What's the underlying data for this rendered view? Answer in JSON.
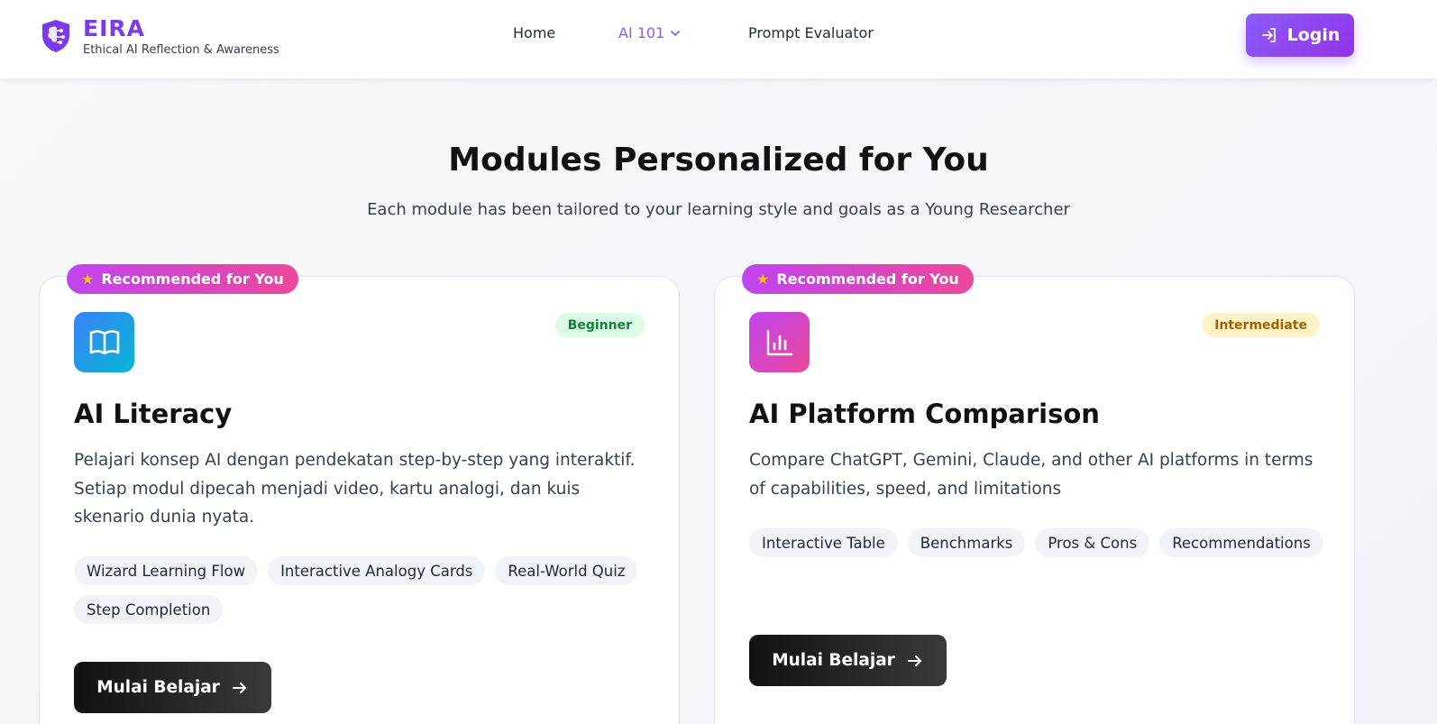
{
  "brand": {
    "name": "EIRA",
    "tagline": "Ethical AI Reflection & Awareness",
    "icon": "shield-brain-icon",
    "accent_color": "#7c3aed"
  },
  "nav": {
    "home": "Home",
    "ai101": "AI 101",
    "prompt_evaluator": "Prompt Evaluator",
    "login": "Login"
  },
  "hero": {
    "title": "Modules Personalized for You",
    "subtitle": "Each module has been tailored to your learning style and goals as a Young Researcher"
  },
  "modules": [
    {
      "badge": "Recommended for You",
      "level": "Beginner",
      "icon": "book-open-icon",
      "title": "AI Literacy",
      "description": "Pelajari konsep AI dengan pendekatan step-by-step yang interaktif. Setiap modul dipecah menjadi video, kartu analogi, dan kuis skenario dunia nyata.",
      "tags": [
        "Wizard Learning Flow",
        "Interactive Analogy Cards",
        "Real-World Quiz",
        "Step Completion"
      ],
      "cta": "Mulai Belajar"
    },
    {
      "badge": "Recommended for You",
      "level": "Intermediate",
      "icon": "bar-chart-icon",
      "title": "AI Platform Comparison",
      "description": "Compare ChatGPT, Gemini, Claude, and other AI platforms in terms of capabilities, speed, and limitations",
      "tags": [
        "Interactive Table",
        "Benchmarks",
        "Pros & Cons",
        "Recommendations"
      ],
      "cta": "Mulai Belajar"
    }
  ]
}
